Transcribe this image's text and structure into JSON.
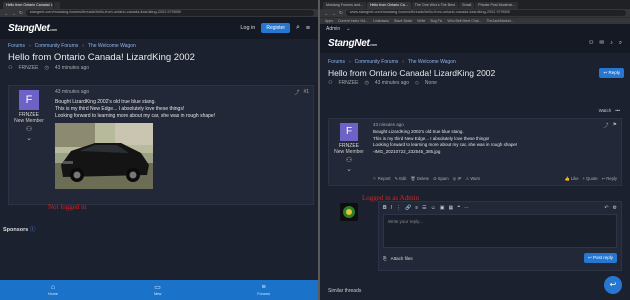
{
  "left": {
    "tabs": [
      "Hello from Ontario Canada! LizardKing 2002",
      "",
      ""
    ],
    "url": "stangnet.com/mustang-forums/threads/hello-from-ontario-canada-lizardking-2002.979505/",
    "logo": "StangNet",
    "logo_suffix": ".com",
    "login_label": "Log in",
    "register_label": "Register",
    "breadcrumbs": [
      "Forums",
      "Community Forums",
      "The Welcome Wagon"
    ],
    "thread_title": "Hello from Ontario Canada! LizardKing 2002",
    "thread_author": "FRNZEE",
    "thread_time": "43 minutes ago",
    "post": {
      "avatar_letter": "F",
      "username": "FRNZEE",
      "role": "New Member",
      "date": "43 minutes ago",
      "number": "#1",
      "lines": [
        "Bought LizardKing 2002's old true blue stang.",
        "This is my third New Edge... I absolutely love these things!",
        "Looking forward to learning more about my car, she was in rough shape!"
      ]
    },
    "annotation": "Not logged in",
    "sponsors_label": "Sponsors",
    "bottom_bar": [
      "Home",
      "New",
      "Forums"
    ]
  },
  "right": {
    "tabs": [
      "Mustang Forums and...",
      "Hello from Ontario Ca...",
      "The One Who's The Best",
      "Gmail",
      "Private Post Moderat..."
    ],
    "url": "www.stangnet.com/mustang-forums/threads/hello-from-ontario-canada-lizardking-2002.979505/",
    "bookmarks": [
      "Apps",
      "Current Index Vid...",
      "Linkbases",
      "Slave Mode",
      "Write",
      "Bug Fix",
      "Who Belt Meet Chal...",
      "TheJaneMarket..."
    ],
    "admin_label": "Admin",
    "logo": "StangNet",
    "logo_suffix": ".com",
    "breadcrumbs": [
      "Forums",
      "Community Forums",
      "The Welcome Wagon"
    ],
    "thread_title": "Hello from Ontario Canada! LizardKing 2002",
    "reply_button": "Reply",
    "thread_author": "FRNZEE",
    "thread_time": "43 minutes ago",
    "thread_status": "None",
    "watch_label": "Watch",
    "post": {
      "avatar_letter": "F",
      "username": "FRNZEE",
      "role": "New Member",
      "date": "43 minutes ago",
      "lines": [
        "Bought LizardKing 2002's old true blue stang.",
        "This is my third New Edge... I absolutely love these things!",
        "Looking forward to learning more about my car, she was in rough shape!"
      ],
      "image_caption": "IMG_20210722_232545_385.jpg",
      "actions": [
        "Report",
        "Edit",
        "Delete",
        "Spam",
        "IP",
        "Warn"
      ],
      "actions_right": [
        "Like",
        "Quote",
        "Reply"
      ]
    },
    "annotation": "Logged in as Admin",
    "editor_placeholder": "Write your reply...",
    "attach_label": "Attach files",
    "post_reply_button": "Post reply",
    "similar_label": "Similar threads"
  }
}
